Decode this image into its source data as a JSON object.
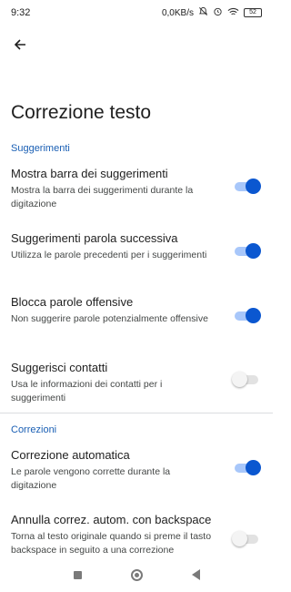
{
  "status_bar": {
    "time": "9:32",
    "net_speed": "0,0KB/s",
    "battery": "52"
  },
  "header": {
    "title": "Correzione testo"
  },
  "sections": [
    {
      "header": "Suggerimenti",
      "items": [
        {
          "title": "Mostra barra dei suggerimenti",
          "summary": "Mostra la barra dei suggerimenti durante la digitazione",
          "enabled": true
        },
        {
          "title": "Suggerimenti parola successiva",
          "summary": "Utilizza le parole precedenti per i suggerimenti",
          "enabled": true
        },
        {
          "title": "Blocca parole offensive",
          "summary": "Non suggerire parole potenzialmente offensive",
          "enabled": true
        },
        {
          "title": "Suggerisci contatti",
          "summary": "Usa le informazioni dei contatti per i suggerimenti",
          "enabled": false
        }
      ]
    },
    {
      "header": "Correzioni",
      "items": [
        {
          "title": "Correzione automatica",
          "summary": "Le parole vengono corrette durante la digitazione",
          "enabled": true
        },
        {
          "title": "Annulla correz. autom. con backspace",
          "summary": "Torna al testo originale quando si preme il tasto backspace in seguito a una correzione automatica",
          "enabled": false
        }
      ]
    }
  ],
  "colors": {
    "accent": "#0b57d0",
    "section_header": "#1a5fb4"
  },
  "icons": {
    "back": "arrow-back-icon",
    "nav_recents": "square-icon",
    "nav_home": "circle-icon",
    "nav_back": "triangle-back-icon"
  }
}
